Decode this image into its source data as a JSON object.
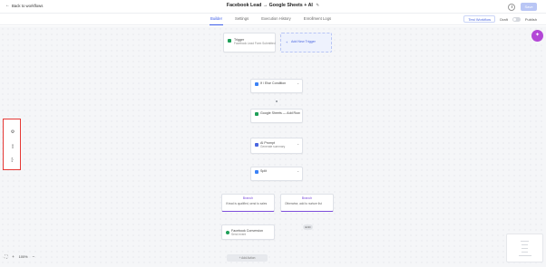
{
  "header": {
    "back_label": "Back to workflows",
    "title": "Facebook Lead → Google Sheets + AI",
    "save_label": "Save"
  },
  "tabs": [
    {
      "label": "Builder",
      "active": true
    },
    {
      "label": "Settings"
    },
    {
      "label": "Execution History"
    },
    {
      "label": "Enrollment Logs"
    }
  ],
  "tab_actions": {
    "test_workflow_label": "Test Workflow",
    "draft_label": "Draft",
    "published_label": "Publish"
  },
  "trigger": {
    "label": "Trigger",
    "sub": "Facebook Lead Form Submitted",
    "add_trigger_label": "Add New Trigger"
  },
  "nodes": {
    "condition": {
      "label": "If / Else Condition"
    },
    "sheet": {
      "label": "Google Sheets — Add Row"
    },
    "ai": {
      "label": "AI Prompt",
      "sub": "Generate summary"
    },
    "split": {
      "label": "Split"
    }
  },
  "branches": {
    "left": {
      "title": "Branch",
      "sub": "If lead is qualified, send to sales"
    },
    "right": {
      "title": "Branch",
      "sub": "Otherwise, add to nurture list"
    }
  },
  "fb_node": {
    "label": "Facebook Conversion",
    "sub": "Send event"
  },
  "end_pill": "END",
  "bottom_pill": "+ Add Action",
  "zoom": {
    "percent": "100%"
  },
  "icons": {
    "back": "arrow-left-icon",
    "history": "history-icon",
    "magic": "magic-wand-icon",
    "tool1": "settings-icon",
    "tool2": "document-icon",
    "tool3": "bracket-icon"
  },
  "colors": {
    "accent": "#3b5be8",
    "highlight": "#e53935",
    "magic": "#b347d6",
    "branch": "#7c4ddb",
    "sheets": "#1e9f58"
  }
}
